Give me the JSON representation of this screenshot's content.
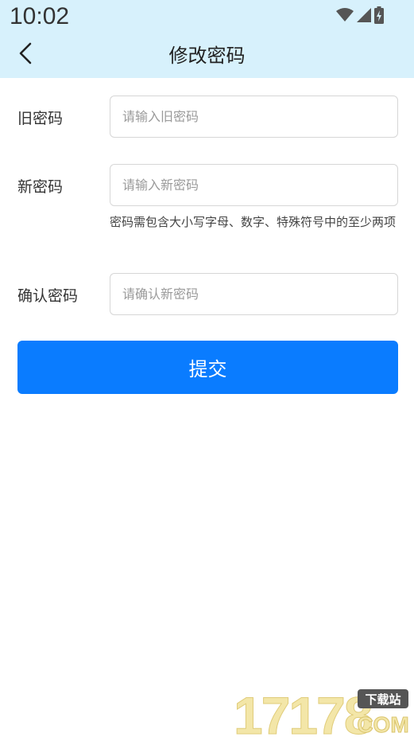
{
  "status_bar": {
    "time": "10:02"
  },
  "header": {
    "title": "修改密码"
  },
  "form": {
    "old_password": {
      "label": "旧密码",
      "placeholder": "请输入旧密码"
    },
    "new_password": {
      "label": "新密码",
      "placeholder": "请输入新密码",
      "hint": "密码需包含大小写字母、数字、特殊符号中的至少两项"
    },
    "confirm_password": {
      "label": "确认密码",
      "placeholder": "请确认新密码"
    }
  },
  "submit": {
    "label": "提交"
  },
  "watermark": {
    "brand": "17178",
    "domain": "COM",
    "tag": "下载站"
  },
  "colors": {
    "header_bg": "#d7f1fc",
    "button": "#0a7cff"
  }
}
